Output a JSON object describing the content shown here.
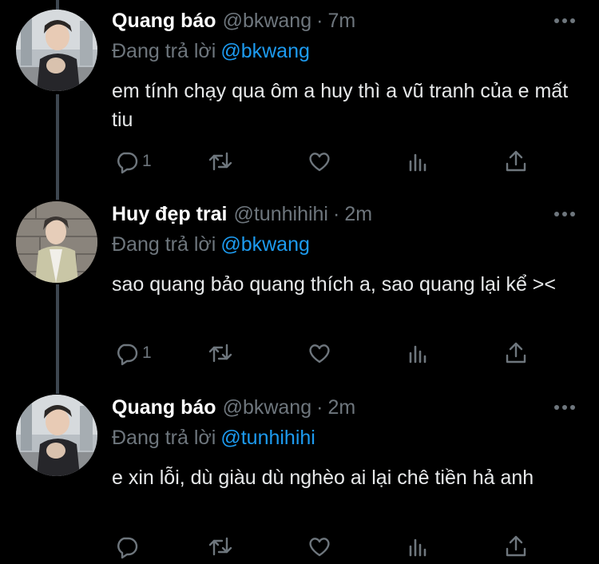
{
  "colors": {
    "background": "#000000",
    "text": "#e7e9ea",
    "muted": "#6e767d",
    "accent": "#1d9bf0",
    "thread_line": "#3d4650"
  },
  "tweets": [
    {
      "name": "Quang báo",
      "handle": "@bkwang",
      "dot": "·",
      "time": "7m",
      "replying_label": "Đang trả lời",
      "replying_to": "@bkwang",
      "text": "em tính chạy qua ôm a huy thì a vũ tranh của e mất tiu",
      "reply_count": "1",
      "icons": [
        "more-icon",
        "reply-icon",
        "retweet-icon",
        "like-icon",
        "analytics-icon",
        "share-icon"
      ]
    },
    {
      "name": "Huy đẹp trai",
      "handle": "@tunhihihi",
      "dot": "·",
      "time": "2m",
      "replying_label": "Đang trả lời",
      "replying_to": "@bkwang",
      "text": "sao quang bảo quang thích a, sao quang lại kể ><",
      "reply_count": "1",
      "icons": [
        "more-icon",
        "reply-icon",
        "retweet-icon",
        "like-icon",
        "analytics-icon",
        "share-icon"
      ]
    },
    {
      "name": "Quang báo",
      "handle": "@bkwang",
      "dot": "·",
      "time": "2m",
      "replying_label": "Đang trả lời",
      "replying_to": "@tunhihihi",
      "text": "e xin lỗi, dù giàu dù nghèo ai lại chê tiền hả anh",
      "reply_count": "",
      "icons": [
        "more-icon",
        "reply-icon",
        "retweet-icon",
        "like-icon",
        "analytics-icon",
        "share-icon"
      ]
    }
  ]
}
